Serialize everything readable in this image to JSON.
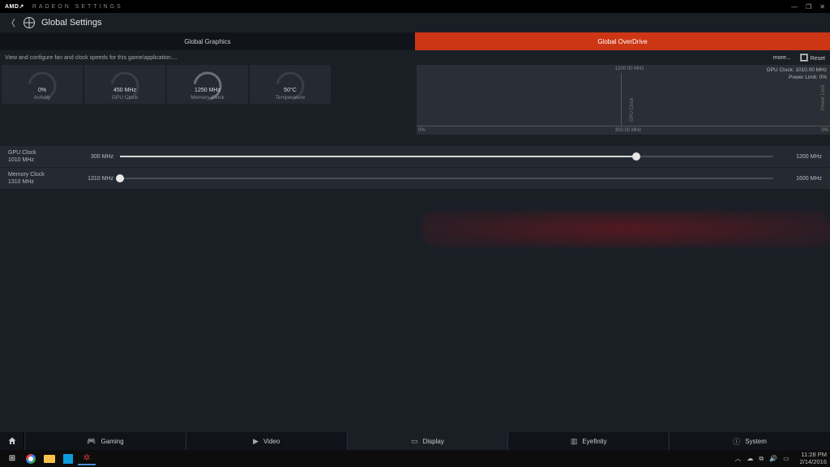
{
  "titlebar": {
    "brand": "AMD",
    "arrow": "↗",
    "app": "RADEON SETTINGS"
  },
  "header": {
    "title": "Global Settings"
  },
  "tabs": {
    "graphics": "Global Graphics",
    "overdrive": "Global OverDrive"
  },
  "infostrip": {
    "hint": "View and configure fan and clock speeds for this game/application....",
    "more": "more...",
    "reset": "Reset"
  },
  "gauges": [
    {
      "value": "0%",
      "label": "Activity"
    },
    {
      "value": "450 MHz",
      "label": "GPU Clock"
    },
    {
      "value": "1250 MHz",
      "label": "Memory Clock"
    },
    {
      "value": "50°C",
      "label": "Temperature"
    }
  ],
  "chart": {
    "legend_line1": "GPU Clock: 1010.00 MHz",
    "legend_line2": "Power Limit: 0%",
    "tick_top_mid": "1200.00 MHz",
    "tick_bot_left": "0%",
    "tick_bot_mid": "300.00 MHz",
    "tick_bot_right": "0%",
    "axis_l": "GPU Clock",
    "axis_r": "Power Limit"
  },
  "sliders": {
    "gpu": {
      "name": "GPU Clock",
      "cur": "1010 MHz",
      "min": "300 MHz",
      "max": "1200 MHz",
      "pct": 79
    },
    "mem": {
      "name": "Memory Clock",
      "cur": "1310 MHz",
      "min": "1310 MHz",
      "max": "1600 MHz",
      "pct": 0
    }
  },
  "bottomnav": {
    "gaming": "Gaming",
    "video": "Video",
    "display": "Display",
    "eyefinity": "Eyefinity",
    "system": "System"
  },
  "taskbar": {
    "time": "11:28 PM",
    "date": "2/14/2016"
  },
  "colors": {
    "accent": "#cc3615"
  }
}
